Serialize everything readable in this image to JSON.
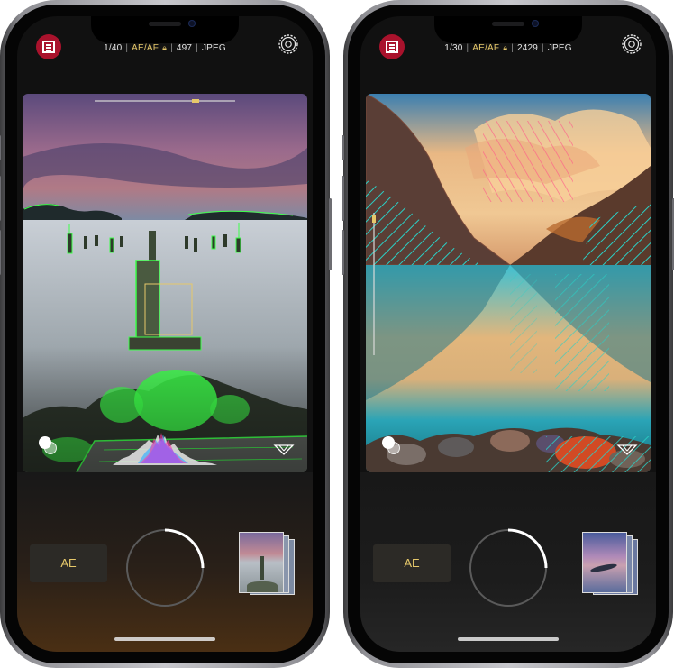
{
  "phones": [
    {
      "status": {
        "shutter": "1/40",
        "mode": "AE/AF",
        "count": "497",
        "format": "JPEG"
      },
      "ae_label": "AE"
    },
    {
      "status": {
        "shutter": "1/30",
        "mode": "AE/AF",
        "count": "2429",
        "format": "JPEG"
      },
      "ae_label": "AE"
    }
  ],
  "icons": [
    "app-logo-icon",
    "lock-icon",
    "gear-icon",
    "exposure-icon",
    "zebra-icon",
    "shutter-button",
    "gallery-thumbnail"
  ],
  "colors": {
    "accent": "#e6c86a",
    "brand": "#a9122c",
    "focus_peaking": "#3dff4a",
    "zebra": "#2ad0c6"
  }
}
